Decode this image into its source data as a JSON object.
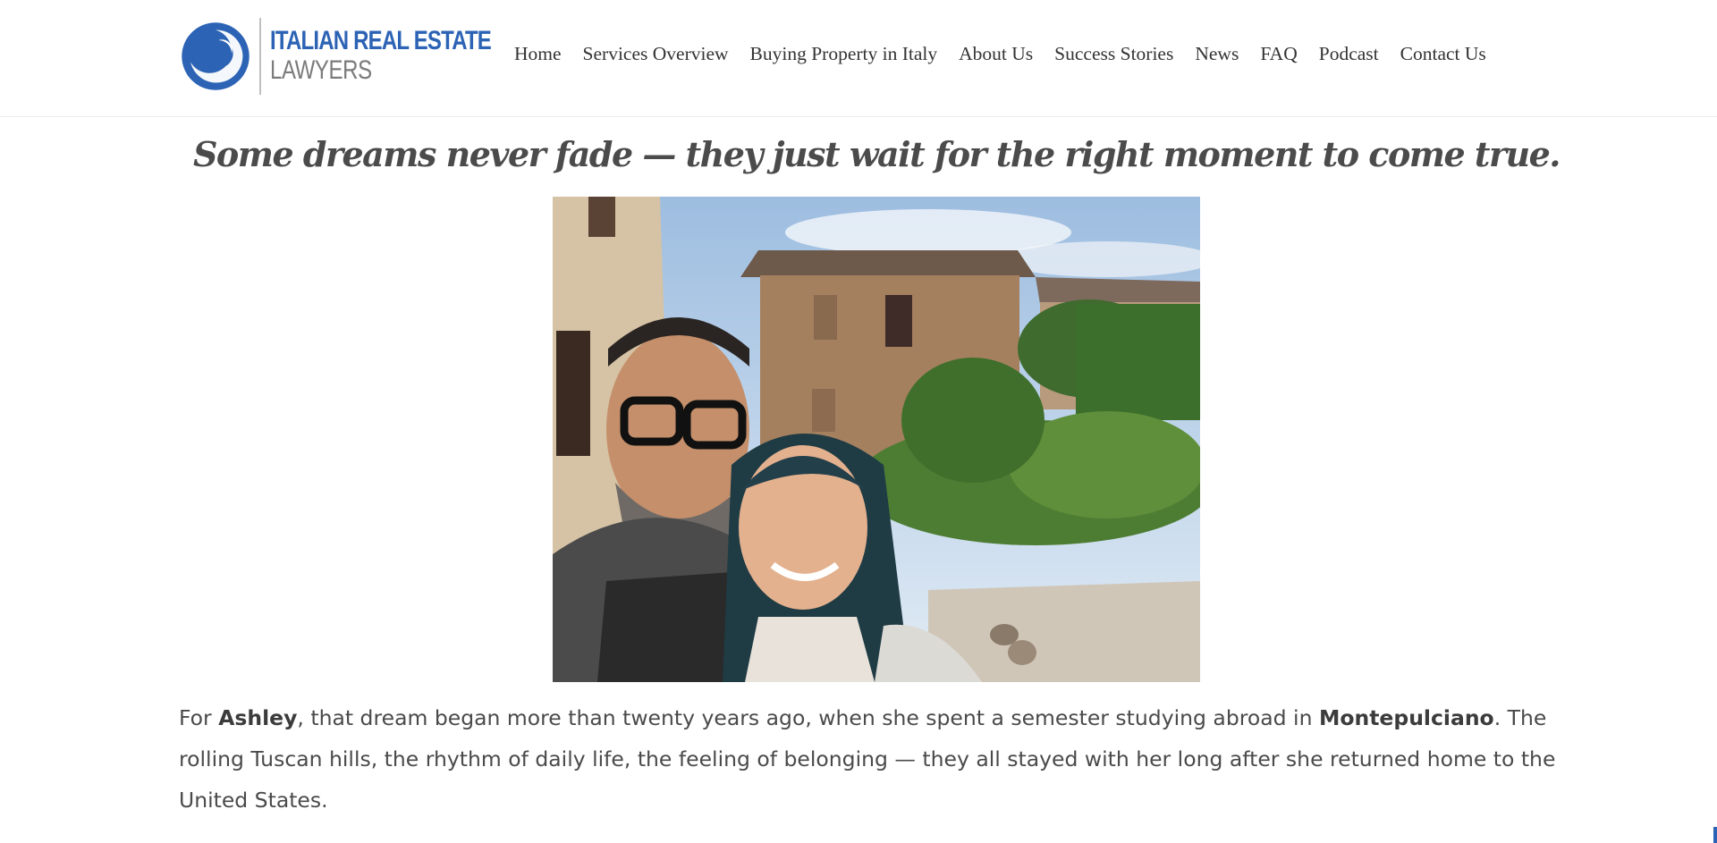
{
  "header": {
    "logo": {
      "line1": "ITALIAN REAL ESTATE",
      "line2": "LAWYERS"
    },
    "nav": [
      {
        "label": "Home"
      },
      {
        "label": "Services Overview"
      },
      {
        "label": "Buying Property in Italy"
      },
      {
        "label": "About Us"
      },
      {
        "label": "Success Stories"
      },
      {
        "label": "News"
      },
      {
        "label": "FAQ"
      },
      {
        "label": "Podcast"
      },
      {
        "label": "Contact Us"
      }
    ]
  },
  "article": {
    "tagline": "Some dreams never fade — they just wait for the right moment to come true.",
    "intro": {
      "p1": "For ",
      "name": "Ashley",
      "p2": ", that dream began more than twenty years ago, when she spent a semester studying abroad in ",
      "place": "Montepulciano",
      "p3": ". The rolling Tuscan hills, the rhythm of daily life, the feeling of belonging — they all stayed with her long after she returned home to the United States."
    }
  },
  "colors": {
    "brand_blue": "#2c63b5",
    "logo_gray": "#7b7b7b",
    "text": "#444444",
    "header_border": "#ececec"
  },
  "icons": {
    "logo": "swirl-logo-icon"
  }
}
